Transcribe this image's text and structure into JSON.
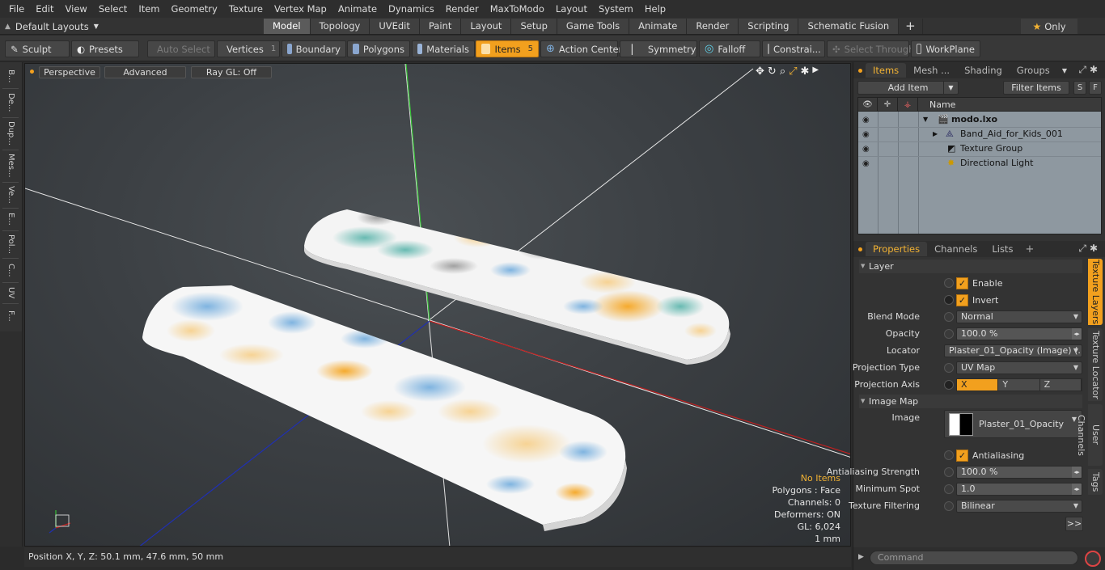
{
  "menu": [
    "File",
    "Edit",
    "View",
    "Select",
    "Item",
    "Geometry",
    "Texture",
    "Vertex Map",
    "Animate",
    "Dynamics",
    "Render",
    "MaxToModo",
    "Layout",
    "System",
    "Help"
  ],
  "layout_selector": "Default Layouts",
  "layout_tabs": [
    "Model",
    "Topology",
    "UVEdit",
    "Paint",
    "Layout",
    "Setup",
    "Game Tools",
    "Animate",
    "Render",
    "Scripting",
    "Schematic Fusion"
  ],
  "active_layout_tab": "Model",
  "only_label": "Only",
  "toolbar": {
    "sculpt": "Sculpt",
    "presets": "Presets",
    "auto_select": "Auto Select",
    "vertices": "Vertices",
    "vertices_count": "1",
    "boundary": "Boundary",
    "polygons": "Polygons",
    "materials": "Materials",
    "items": "Items",
    "items_count": "5",
    "action_center": "Action Center",
    "symmetry": "Symmetry",
    "falloff": "Falloff",
    "constraints": "Constrai...",
    "select_through": "Select Through",
    "workplane": "WorkPlane"
  },
  "left_tabs": [
    "B...",
    "De...",
    "Dup...",
    "Mes...",
    "Ve...",
    "E...",
    "Pol...",
    "C...",
    "UV",
    "F..."
  ],
  "viewport": {
    "perspective": "Perspective",
    "advanced": "Advanced",
    "raygl": "Ray GL: Off",
    "info": {
      "no_items": "No Items",
      "polygons": "Polygons : Face",
      "channels": "Channels: 0",
      "deformers": "Deformers: ON",
      "gl": "GL: 6,024",
      "unit": "1 mm"
    }
  },
  "status": "Position X, Y, Z:   50.1 mm, 47.6 mm, 50 mm",
  "items_panel": {
    "tabs": [
      "Items",
      "Mesh ...",
      "Shading",
      "Groups"
    ],
    "add_item": "Add Item",
    "filter_items": "Filter Items",
    "s_btn": "S",
    "f_btn": "F",
    "name_header": "Name",
    "rows": [
      {
        "label": "modo.lxo"
      },
      {
        "label": "Band_Aid_for_Kids_001"
      },
      {
        "label": "Texture Group"
      },
      {
        "label": "Directional Light"
      }
    ]
  },
  "properties_panel": {
    "tabs": [
      "Properties",
      "Channels",
      "Lists"
    ],
    "layer_section": "Layer",
    "enable": "Enable",
    "invert": "Invert",
    "blend_mode_label": "Blend Mode",
    "blend_mode": "Normal",
    "opacity_label": "Opacity",
    "opacity": "100.0 %",
    "locator_label": "Locator",
    "locator": "Plaster_01_Opacity (Image) (...",
    "projection_type_label": "Projection Type",
    "projection_type": "UV Map",
    "projection_axis_label": "Projection Axis",
    "axes": [
      "X",
      "Y",
      "Z"
    ],
    "image_map_section": "Image Map",
    "image_label": "Image",
    "image": "Plaster_01_Opacity",
    "antialiasing": "Antialiasing",
    "aa_strength_label": "Antialiasing Strength",
    "aa_strength": "100.0 %",
    "min_spot_label": "Minimum Spot",
    "min_spot": "1.0",
    "tex_filter_label": "Texture Filtering",
    "tex_filter": "Bilinear",
    "more": ">>",
    "side_tabs": [
      "Texture Layers",
      "Texture Locator",
      "User Channels",
      "Tags"
    ]
  },
  "command_placeholder": "Command",
  "colors": {
    "accent": "#f2a01e",
    "highlight_text": "#f2b233"
  }
}
